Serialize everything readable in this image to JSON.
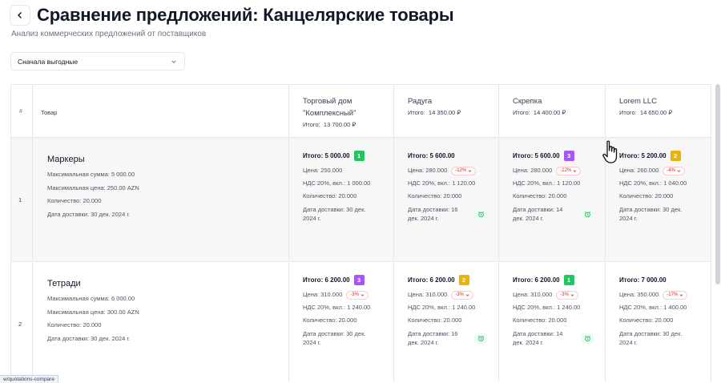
{
  "header": {
    "title": "Сравнение предложений: Канцелярские товары",
    "subtitle": "Анализ коммерческих предложений от поставщиков"
  },
  "sort": {
    "selected": "Сначала выгодные"
  },
  "table": {
    "headers": {
      "num": "#",
      "product": "Товар"
    },
    "suppliers": [
      {
        "name": "Торговый дом \"Комплексный\"",
        "total_label": "Итого:",
        "total_value": "13 700.00 ₽"
      },
      {
        "name": "Радуга",
        "total_label": "Итого:",
        "total_value": "14 350.00 ₽"
      },
      {
        "name": "Скрепка",
        "total_label": "Итого:",
        "total_value": "14 400.00 ₽"
      },
      {
        "name": "Lorem LLC",
        "total_label": "Итого:",
        "total_value": "14 650.00 ₽"
      }
    ],
    "rows": [
      {
        "num": "1",
        "product": {
          "name": "Маркеры",
          "max_sum": "Максимальная сумма: 5 000.00",
          "max_price": "Максимальная цена: 250.00 AZN",
          "qty": "Количество: 20.000",
          "delivery": "Дата доставки: 30 дек. 2024 г."
        },
        "offers": [
          {
            "total": "Итого: 5 000.00",
            "rank": "1",
            "price": "Цена: 250.000",
            "diff": "",
            "vat": "НДС 20%, вкл.: 1 000.00",
            "qty": "Количество: 20.000",
            "delivery": "Дата доставки: 30 дек. 2024 г.",
            "alarm": false
          },
          {
            "total": "Итого: 5 600.00",
            "rank": "",
            "price": "Цена: 280.000",
            "diff": "-12%",
            "vat": "НДС 20%, вкл.: 1 120.00",
            "qty": "Количество: 20.000",
            "delivery": "Дата доставки: 16 дек. 2024 г.",
            "alarm": true
          },
          {
            "total": "Итого: 5 600.00",
            "rank": "3",
            "price": "Цена: 280.000",
            "diff": "-12%",
            "vat": "НДС 20%, вкл.: 1 120.00",
            "qty": "Количество: 20.000",
            "delivery": "Дата доставки: 14 дек. 2024 г.",
            "alarm": true
          },
          {
            "total": "Итого: 5 200.00",
            "rank": "2",
            "price": "Цена: 260.000",
            "diff": "-4%",
            "vat": "НДС 20%, вкл.: 1 040.00",
            "qty": "Количество: 20.000",
            "delivery": "Дата доставки: 30 дек. 2024 г.",
            "alarm": false
          }
        ]
      },
      {
        "num": "2",
        "product": {
          "name": "Тетради",
          "max_sum": "Максимальная сумма: 6 000.00",
          "max_price": "Максимальная цена: 300.00 AZN",
          "qty": "Количество: 20.000",
          "delivery": "Дата доставки: 30 дек. 2024 г."
        },
        "offers": [
          {
            "total": "Итого: 6 200.00",
            "rank": "3",
            "price": "Цена: 310.000",
            "diff": "-3%",
            "vat": "НДС 20%, вкл.: 1 240.00",
            "qty": "Количество: 20.000",
            "delivery": "Дата доставки: 30 дек. 2024 г.",
            "alarm": false
          },
          {
            "total": "Итого: 6 200.00",
            "rank": "2",
            "price": "Цена: 310.000",
            "diff": "-3%",
            "vat": "НДС 20%, вкл.: 1 240.00",
            "qty": "Количество: 20.000",
            "delivery": "Дата доставки: 16 дек. 2024 г.",
            "alarm": true
          },
          {
            "total": "Итого: 6 200.00",
            "rank": "1",
            "price": "Цена: 310.000",
            "diff": "-3%",
            "vat": "НДС 20%, вкл.: 1 240.00",
            "qty": "Количество: 20.000",
            "delivery": "Дата доставки: 14 дек. 2024 г.",
            "alarm": true
          },
          {
            "total": "Итого: 7 000.00",
            "rank": "",
            "price": "Цена: 350.000",
            "diff": "-17%",
            "vat": "НДС 20%, вкл.: 1 400.00",
            "qty": "Количество: 20.000",
            "delivery": "Дата доставки: 30 дек. 2024 г.",
            "alarm": false
          }
        ]
      }
    ]
  },
  "rank_colors": {
    "1": "#22c55e",
    "2": "#eab308",
    "3": "#a855f7"
  },
  "status_bar": {
    "url": "w/quotations-compare"
  }
}
